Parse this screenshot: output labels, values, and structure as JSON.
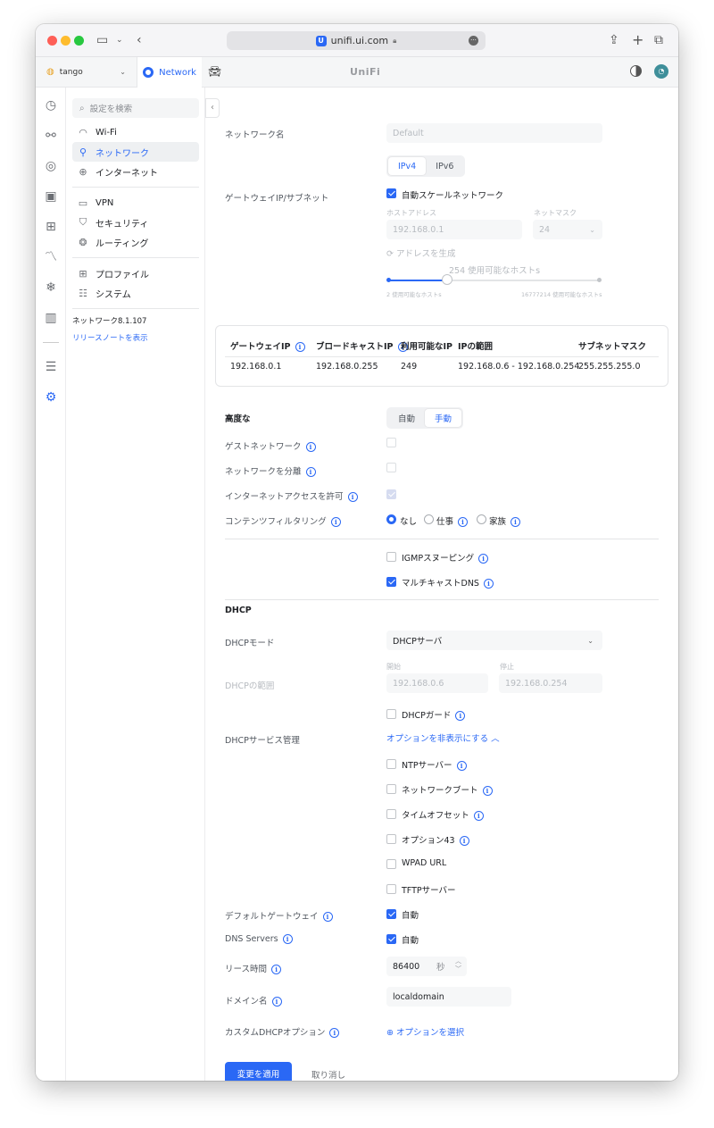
{
  "browser": {
    "url": "unifi.ui.com"
  },
  "topnav": {
    "site": "tango",
    "app": "Network",
    "brand": "UniFi"
  },
  "sidebar": {
    "search_placeholder": "設定を検索",
    "items": [
      {
        "label": "Wi-Fi"
      },
      {
        "label": "ネットワーク"
      },
      {
        "label": "インターネット"
      },
      {
        "label": "VPN"
      },
      {
        "label": "セキュリティ"
      },
      {
        "label": "ルーティング"
      },
      {
        "label": "プロファイル"
      },
      {
        "label": "システム"
      }
    ],
    "version": "ネットワーク8.1.107",
    "release_notes": "リリースノートを表示"
  },
  "form": {
    "network_name": {
      "label": "ネットワーク名",
      "value": "Default"
    },
    "ip_tabs": [
      "IPv4",
      "IPv6"
    ],
    "gateway": {
      "label": "ゲートウェイIP/サブネット",
      "auto_scale": "自動スケールネットワーク",
      "host_label": "ホストアドレス",
      "host_value": "192.168.0.1",
      "mask_label": "ネットマスク",
      "mask_value": "24",
      "generate": "アドレスを生成",
      "usable_hosts": "254 使用可能なホストs",
      "min_hosts": "2 使用可能なホストs",
      "max_hosts": "16777214 使用可能なホストs",
      "slider_fraction": 0.28
    },
    "summary": {
      "headers": [
        "ゲートウェイIP",
        "ブロードキャストIP",
        "利用可能なIP",
        "IPの範囲",
        "サブネットマスク"
      ],
      "row": [
        "192.168.0.1",
        "192.168.0.255",
        "249",
        "192.168.0.6 - 192.168.0.254",
        "255.255.255.0"
      ]
    },
    "advanced": {
      "label": "高度な",
      "tabs": [
        "自動",
        "手動"
      ]
    },
    "guest_network": "ゲストネットワーク",
    "isolate_network": "ネットワークを分離",
    "allow_internet": "インターネットアクセスを許可",
    "content_filter": {
      "label": "コンテンツフィルタリング",
      "options": [
        "なし",
        "仕事",
        "家族"
      ]
    },
    "igmp": "IGMPスヌーピング",
    "multicast_dns": "マルチキャストDNS",
    "dhcp": {
      "section": "DHCP",
      "mode_label": "DHCPモード",
      "mode_value": "DHCPサーバ",
      "range_label": "DHCPの範囲",
      "start_label": "開始",
      "start_value": "192.168.0.6",
      "end_label": "停止",
      "end_value": "192.168.0.254",
      "guard": "DHCPガード",
      "service_label": "DHCPサービス管理",
      "hide_options": "オプションを非表示にする",
      "options": [
        "NTPサーバー",
        "ネットワークブート",
        "タイムオフセット",
        "オプション43",
        "WPAD URL",
        "TFTPサーバー"
      ],
      "default_gateway_label": "デフォルトゲートウェイ",
      "default_gateway_value": "自動",
      "dns_label": "DNS Servers",
      "dns_value": "自動",
      "lease_label": "リース時間",
      "lease_value": "86400",
      "lease_unit": "秒",
      "domain_label": "ドメイン名",
      "domain_value": "localdomain",
      "custom_label": "カスタムDHCPオプション",
      "custom_action": "オプションを選択"
    },
    "apply": "変更を適用",
    "cancel": "取り消し"
  }
}
